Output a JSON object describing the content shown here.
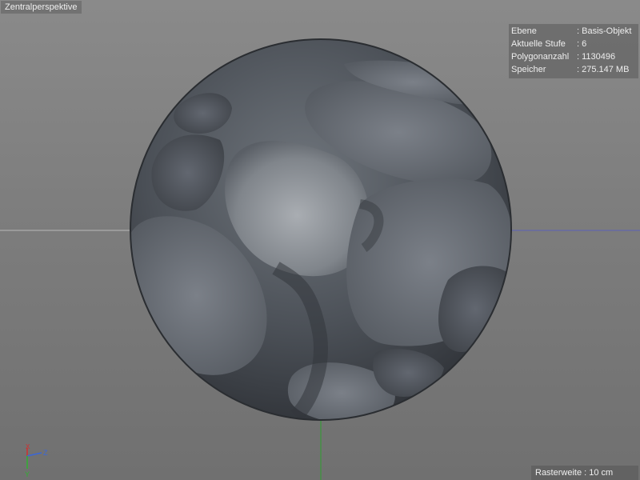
{
  "viewport": {
    "camera_label": "Zentralperspektive"
  },
  "hud": {
    "rows": [
      {
        "key": "Ebene",
        "value": ": Basis-Objekt"
      },
      {
        "key": "Aktuelle Stufe",
        "value": ": 6"
      },
      {
        "key": "Polygonanzahl",
        "value": ": 1130496"
      },
      {
        "key": "Speicher",
        "value": ": 275.147 MB"
      }
    ]
  },
  "footer": {
    "grid_label": "Rasterweite : 10 cm"
  },
  "axis_gizmo": {
    "x": "X",
    "y": "Y",
    "z": "Z",
    "colors": {
      "x": "#d03030",
      "y": "#30b030",
      "z": "#3a66d8"
    }
  },
  "icons": {
    "sphere": "sculpted-sphere",
    "axis": "axis-gizmo-icon"
  }
}
